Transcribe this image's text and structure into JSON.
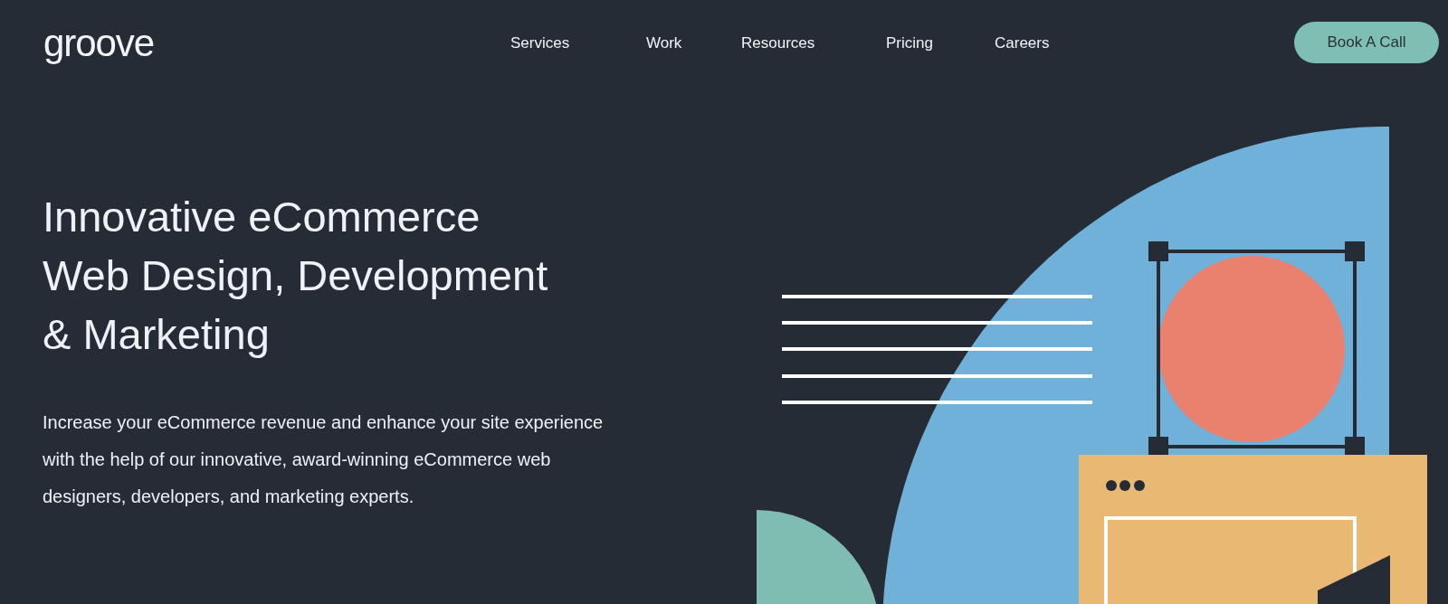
{
  "logo": "groove",
  "nav": [
    {
      "label": "Services"
    },
    {
      "label": "Work"
    },
    {
      "label": "Resources"
    },
    {
      "label": "Pricing"
    },
    {
      "label": "Careers"
    }
  ],
  "cta": "Book A Call",
  "hero": {
    "heading_lines": [
      "Innovative eCommerce",
      "Web Design, Development",
      "& Marketing"
    ],
    "description": "Increase your eCommerce revenue and enhance your site experience with the help of our innovative, award-winning eCommerce web designers, developers, and marketing experts."
  }
}
